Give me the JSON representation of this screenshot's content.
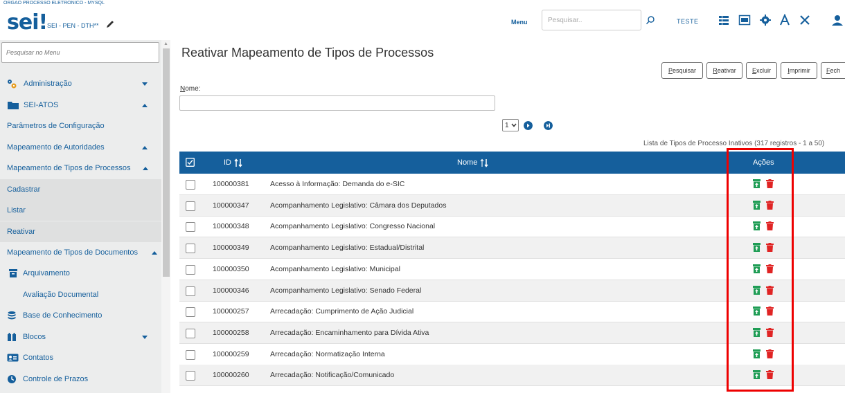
{
  "header": {
    "org": "ORGAO PROCESSO ELETRONICO - MYSQL",
    "logo": "sei",
    "system": "SEI - PEN - DTH**",
    "menu_label": "Menu",
    "search_placeholder": "Pesquisar..",
    "unit": "TESTE",
    "icons": [
      "grid-icon",
      "calendar-icon",
      "gear-icon",
      "font-icon",
      "tools-icon",
      "user-icon"
    ]
  },
  "sidebar": {
    "search_placeholder": "Pesquisar no Menu",
    "items": [
      {
        "label": "Administração",
        "icon": "gears-icon",
        "caret": "down"
      },
      {
        "label": "SEI-ATOS",
        "icon": "folder-icon",
        "caret": "up"
      },
      {
        "label": "Parâmetros de Configuração"
      },
      {
        "label": "Mapeamento de Autoridades",
        "caret": "up"
      },
      {
        "label": "Mapeamento de Tipos de Processos",
        "caret": "up"
      },
      {
        "label": "Cadastrar"
      },
      {
        "label": "Listar"
      },
      {
        "label": "Reativar"
      },
      {
        "label": "Mapeamento de Tipos de Documentos",
        "caret": "up"
      },
      {
        "label": "Arquivamento",
        "icon": "archive-icon"
      },
      {
        "label": "Avaliação Documental"
      },
      {
        "label": "Base de Conhecimento",
        "icon": "database-icon"
      },
      {
        "label": "Blocos",
        "icon": "blocks-icon",
        "caret": "down"
      },
      {
        "label": "Contatos",
        "icon": "contact-card-icon"
      },
      {
        "label": "Controle de Prazos",
        "icon": "clock-icon"
      }
    ]
  },
  "main": {
    "title": "Reativar Mapeamento de Tipos de Processos",
    "buttons": {
      "pesquisar": {
        "first": "P",
        "rest": "esquisar"
      },
      "reativar": {
        "first": "R",
        "rest": "eativar"
      },
      "excluir": {
        "first": "E",
        "rest": "xcluir"
      },
      "imprimir": {
        "first": "I",
        "rest": "mprimir"
      },
      "fechar": {
        "first": "F",
        "rest": "ech"
      }
    },
    "nome_label_first": "N",
    "nome_label_rest": "ome:",
    "pager_value": "1",
    "list_caption": "Lista de Tipos de Processo Inativos (317 registros - 1 a 50)",
    "table": {
      "headers": {
        "id": "ID",
        "nome": "Nome",
        "acoes": "Ações"
      },
      "rows": [
        {
          "id": "100000381",
          "nome": "Acesso à Informação: Demanda do e-SIC"
        },
        {
          "id": "100000347",
          "nome": "Acompanhamento Legislativo: Câmara dos Deputados"
        },
        {
          "id": "100000348",
          "nome": "Acompanhamento Legislativo: Congresso Nacional"
        },
        {
          "id": "100000349",
          "nome": "Acompanhamento Legislativo: Estadual/Distrital"
        },
        {
          "id": "100000350",
          "nome": "Acompanhamento Legislativo: Municipal"
        },
        {
          "id": "100000346",
          "nome": "Acompanhamento Legislativo: Senado Federal"
        },
        {
          "id": "100000257",
          "nome": "Arrecadação: Cumprimento de Ação Judicial"
        },
        {
          "id": "100000258",
          "nome": "Arrecadação: Encaminhamento para Dívida Ativa"
        },
        {
          "id": "100000259",
          "nome": "Arrecadação: Normatização Interna"
        },
        {
          "id": "100000260",
          "nome": "Arrecadação: Notificação/Comunicado"
        }
      ]
    }
  },
  "colors": {
    "brand": "#155f9c",
    "reactivate": "#1f9d55",
    "delete": "#e02424",
    "highlight": "#ee0000"
  }
}
